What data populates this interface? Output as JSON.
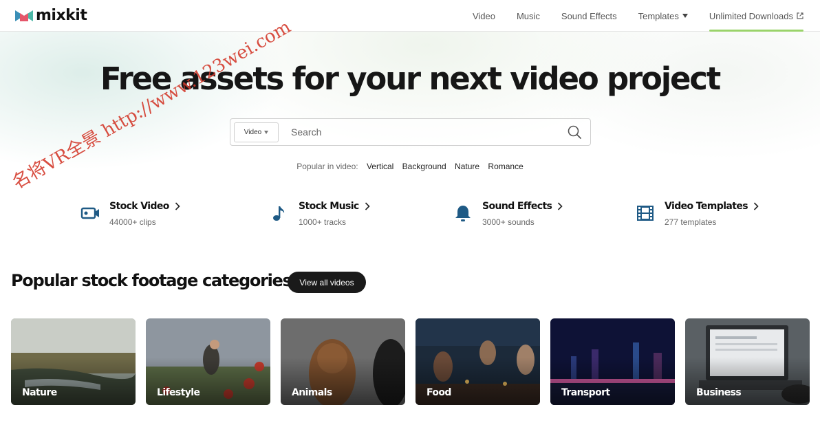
{
  "brand": {
    "name": "mixkit"
  },
  "nav": {
    "items": [
      {
        "label": "Video"
      },
      {
        "label": "Music"
      },
      {
        "label": "Sound Effects"
      },
      {
        "label": "Templates"
      },
      {
        "label": "Unlimited Downloads"
      }
    ]
  },
  "hero": {
    "headline": "Free assets for your next video project",
    "search": {
      "type_label": "Video",
      "placeholder": "Search"
    },
    "popular": {
      "label": "Popular in video:",
      "tags": [
        "Vertical",
        "Background",
        "Nature",
        "Romance"
      ]
    }
  },
  "assets": [
    {
      "title": "Stock Video",
      "subtitle": "44000+ clips",
      "icon": "video-camera-icon"
    },
    {
      "title": "Stock Music",
      "subtitle": "1000+ tracks",
      "icon": "music-note-icon"
    },
    {
      "title": "Sound Effects",
      "subtitle": "3000+ sounds",
      "icon": "bell-icon"
    },
    {
      "title": "Video Templates",
      "subtitle": "277 templates",
      "icon": "film-strip-icon"
    }
  ],
  "categories": {
    "title": "Popular stock footage categories",
    "view_all_label": "View all videos",
    "items": [
      {
        "label": "Nature"
      },
      {
        "label": "Lifestyle"
      },
      {
        "label": "Animals"
      },
      {
        "label": "Food"
      },
      {
        "label": "Transport"
      },
      {
        "label": "Business"
      }
    ]
  },
  "watermark": {
    "text": "名将VR全景 http://www.123wei.com"
  },
  "colors": {
    "accent": "#9ad36a",
    "icon_blue": "#1f5a85",
    "dark_button": "#1a1a1a"
  }
}
